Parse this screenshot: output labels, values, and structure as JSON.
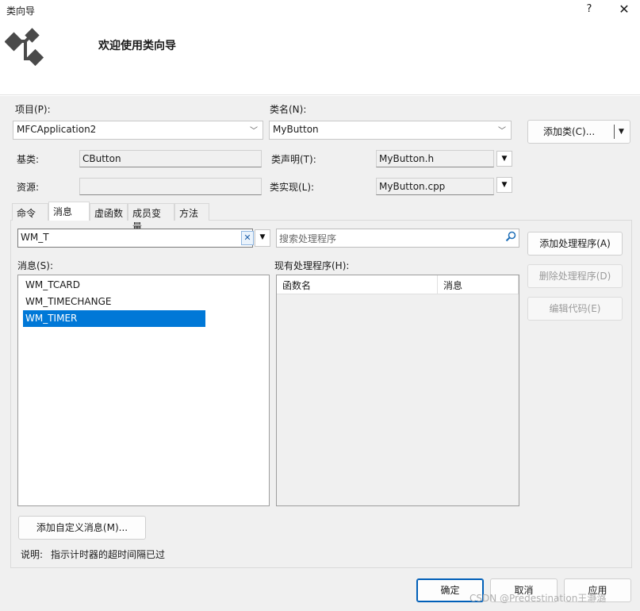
{
  "window": {
    "title": "类向导",
    "help_label": "?",
    "close_label": "✕"
  },
  "banner": {
    "heading": "欢迎使用类向导",
    "icon": "class-wizard-icon"
  },
  "form": {
    "project_label": "项目(P):",
    "project_value": "MFCApplication2",
    "classname_label": "类名(N):",
    "classname_value": "MyButton",
    "add_class_label": "添加类(C)...",
    "base_label": "基类:",
    "base_value": "CButton",
    "decl_label": "类声明(T):",
    "decl_value": "MyButton.h",
    "resource_label": "资源:",
    "resource_value": "",
    "impl_label": "类实现(L):",
    "impl_value": "MyButton.cpp"
  },
  "tabs": [
    {
      "label": "命令",
      "active": false
    },
    {
      "label": "消息",
      "active": true
    },
    {
      "label": "虚函数",
      "active": false
    },
    {
      "label": "成员变量",
      "active": false
    },
    {
      "label": "方法",
      "active": false
    }
  ],
  "messages_tab": {
    "filter_value": "WM_T",
    "search_placeholder": "搜索处理程序",
    "messages_label": "消息(S):",
    "messages": [
      {
        "label": "WM_TCARD",
        "selected": false
      },
      {
        "label": "WM_TIMECHANGE",
        "selected": false
      },
      {
        "label": "WM_TIMER",
        "selected": true
      }
    ],
    "handlers_label": "现有处理程序(H):",
    "handler_columns": [
      "函数名",
      "消息"
    ],
    "add_handler_label": "添加处理程序(A)",
    "delete_handler_label": "删除处理程序(D)",
    "edit_code_label": "编辑代码(E)",
    "add_custom_label": "添加自定义消息(M)...",
    "description_label": "说明:",
    "description_text": "指示计时器的超时间隔已过"
  },
  "footer": {
    "ok_label": "确定",
    "cancel_label": "取消",
    "apply_label": "应用"
  },
  "watermark": "CSDN @Predestination王瀞潞",
  "colors": {
    "selection": "#0078d7",
    "primary_border": "#005fb8",
    "background": "#f0f0f0"
  }
}
